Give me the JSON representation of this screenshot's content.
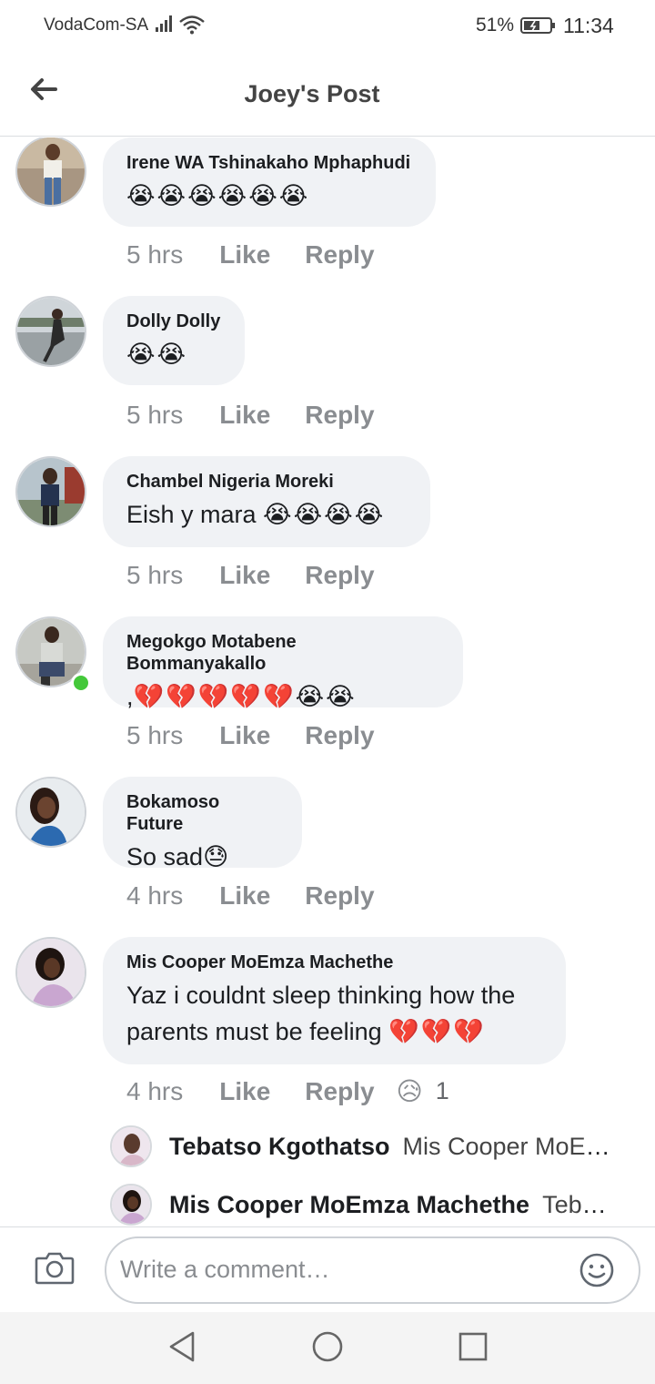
{
  "status_bar": {
    "carrier": "VodaCom-SA",
    "battery_percent": "51%",
    "time": "11:34",
    "icons": [
      "signal-icon",
      "wifi-icon",
      "battery-icon"
    ]
  },
  "header": {
    "title": "Joey's Post",
    "back_icon": "arrow-left-icon"
  },
  "comments": [
    {
      "author": "Irene WA Tshinakaho Mphaphudi",
      "text": "",
      "emoji": "😭😭😭😭😭😭",
      "time": "5 hrs",
      "like": "Like",
      "reply": "Reply"
    },
    {
      "author": "Dolly Dolly",
      "text": "",
      "emoji": "😭😭",
      "time": "5 hrs",
      "like": "Like",
      "reply": "Reply"
    },
    {
      "author": "Chambel Nigeria Moreki",
      "text": "Eish y mara ",
      "emoji": "😭😭😭😭",
      "time": "5 hrs",
      "like": "Like",
      "reply": "Reply"
    },
    {
      "author": "Megokgo Motabene Bommanyakallo",
      "text": ",",
      "emoji": "💔💔💔💔💔😭😭",
      "time": "5 hrs",
      "like": "Like",
      "reply": "Reply",
      "online": true
    },
    {
      "author": "Bokamoso Future",
      "text": "So sad",
      "emoji": "😓",
      "time": "4 hrs",
      "like": "Like",
      "reply": "Reply"
    },
    {
      "author": "Mis Cooper MoEmza Machethe",
      "text": "Yaz i couldnt sleep thinking how the parents must be feeling ",
      "emoji": "💔💔💔",
      "time": "4 hrs",
      "like": "Like",
      "reply": "Reply",
      "reaction_emoji": "😥",
      "reaction_count": "1"
    }
  ],
  "replies": [
    {
      "author": "Tebatso Kgothatso",
      "text": "Mis Cooper MoEmza Machethe"
    },
    {
      "author": "Mis Cooper MoEmza Machethe",
      "text": "Tebatso Kgothatso"
    }
  ],
  "composer": {
    "placeholder": "Write a comment…",
    "camera_icon": "camera-icon",
    "emoji_icon": "smiley-icon"
  },
  "nav_bar": {
    "icons": [
      "nav-back-icon",
      "nav-home-icon",
      "nav-recents-icon"
    ]
  },
  "colors": {
    "bubble": "#f0f2f5",
    "meta_text": "#8a8d91",
    "online": "#44c83a",
    "divider": "#dadde1"
  }
}
